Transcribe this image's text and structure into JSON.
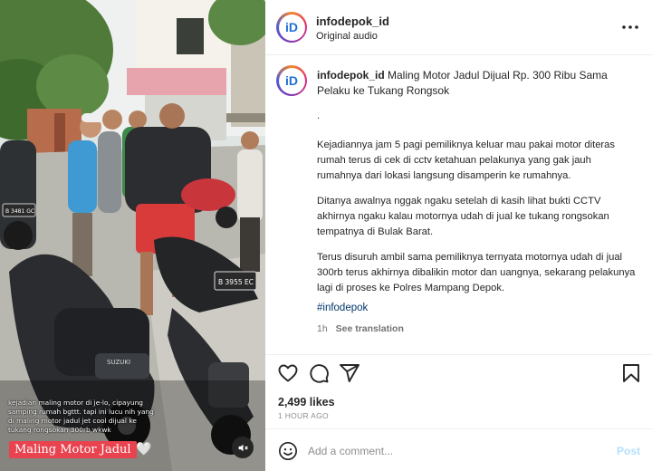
{
  "header": {
    "username": "infodepok_id",
    "subtitle": "Original audio",
    "avatar_text": "iD",
    "more_icon": "more-horizontal-icon"
  },
  "post": {
    "username": "infodepok_id",
    "headline": "Maling Motor Jadul Dijual Rp. 300 Ribu Sama Pelaku ke Tukang Rongsok",
    "dot": ".",
    "paragraphs": [
      "Kejadiannya jam 5 pagi pemiliknya keluar mau pakai motor diteras rumah terus di cek di cctv ketahuan pelakunya yang gak jauh rumahnya dari lokasi langsung disamperin ke rumahnya.",
      "Ditanya awalnya nggak ngaku setelah di kasih lihat bukti CCTV akhirnya ngaku kalau motornya udah di jual ke tukang rongsokan tempatnya di Bulak Barat.",
      "Terus disuruh ambil sama pemiliknya ternyata motornya udah di jual 300rb terus akhirnya dibalikin motor dan uangnya, sekarang pelakunya lagi di proses ke Polres Mampang Depok."
    ],
    "hashtag": "#infodepok",
    "age": "1h",
    "see_translation": "See translation"
  },
  "actions": {
    "likes": "2,499 likes",
    "time_ago": "1 HOUR AGO",
    "icons": [
      "heart-icon",
      "comment-icon",
      "share-icon",
      "bookmark-icon"
    ]
  },
  "comment": {
    "placeholder": "Add a comment...",
    "post_label": "Post"
  },
  "media": {
    "caption": "kejadian maling motor di je-lo, cipayung samping rumah bgttt. tapi ini lucu nih yang di maling motor jadul jet cool dijual ke tukang rongsokan 300rb wkwk",
    "title": "Maling Motor Jadul",
    "title_emoji": "🤍",
    "plate_1": "B 3481 GC",
    "plate_2": "B 3955 EC",
    "mute_icon": "muted-speaker-icon"
  },
  "colors": {
    "accent_link": "#00376b",
    "badge_red": "#e8434f",
    "post_button_disabled": "#b2dffc",
    "muted_text": "#737373"
  }
}
